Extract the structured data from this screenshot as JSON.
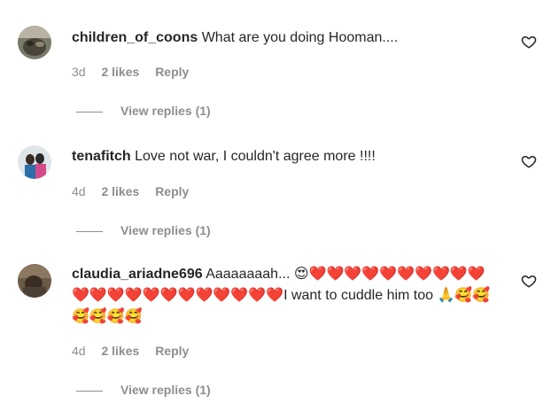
{
  "comments": [
    {
      "username": "children_of_coons",
      "text": "What are you doing Hooman....",
      "time": "3d",
      "likes": "2 likes",
      "reply": "Reply",
      "view_replies": "View replies (1)"
    },
    {
      "username": "tenafitch",
      "text": "Love not war, I couldn't agree more !!!!",
      "time": "4d",
      "likes": "2 likes",
      "reply": "Reply",
      "view_replies": "View replies (1)"
    },
    {
      "username": "claudia_ariadne696",
      "text": "Aaaaaaaah... 😍❤️❤️❤️❤️❤️❤️❤️❤️❤️❤️❤️❤️❤️❤️❤️❤️❤️❤️❤️❤️❤️❤️I want to cuddle him too 🙏🥰🥰🥰🥰🥰🥰",
      "time": "4d",
      "likes": "2 likes",
      "reply": "Reply",
      "view_replies": "View replies (1)"
    }
  ],
  "icons": {
    "like": "heart-outline-icon"
  },
  "colors": {
    "text": "#262626",
    "muted": "#8e8e8e"
  }
}
